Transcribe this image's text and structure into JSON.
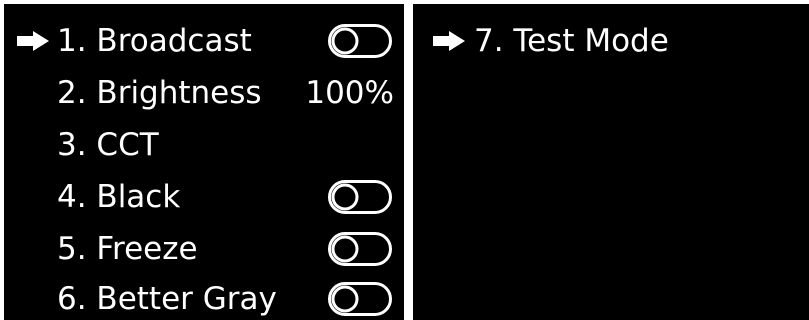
{
  "left_screen": {
    "items": [
      {
        "label": "1. Broadcast",
        "control": "toggle",
        "state": "off",
        "selected": true
      },
      {
        "label": "2. Brightness",
        "value": "100%"
      },
      {
        "label": "3. CCT"
      },
      {
        "label": "4. Black",
        "control": "toggle",
        "state": "off"
      },
      {
        "label": "5. Freeze",
        "control": "toggle",
        "state": "off"
      },
      {
        "label": "6. Better Gray",
        "control": "toggle",
        "state": "off"
      }
    ]
  },
  "right_screen": {
    "items": [
      {
        "label": "7. Test Mode",
        "selected": true
      }
    ]
  },
  "icons": {
    "pointer": "arrow-right-icon",
    "toggle": "toggle-switch-icon"
  },
  "colors": {
    "screen_background": "#000000",
    "text": "#ffffff",
    "frame": "#ffffff"
  }
}
